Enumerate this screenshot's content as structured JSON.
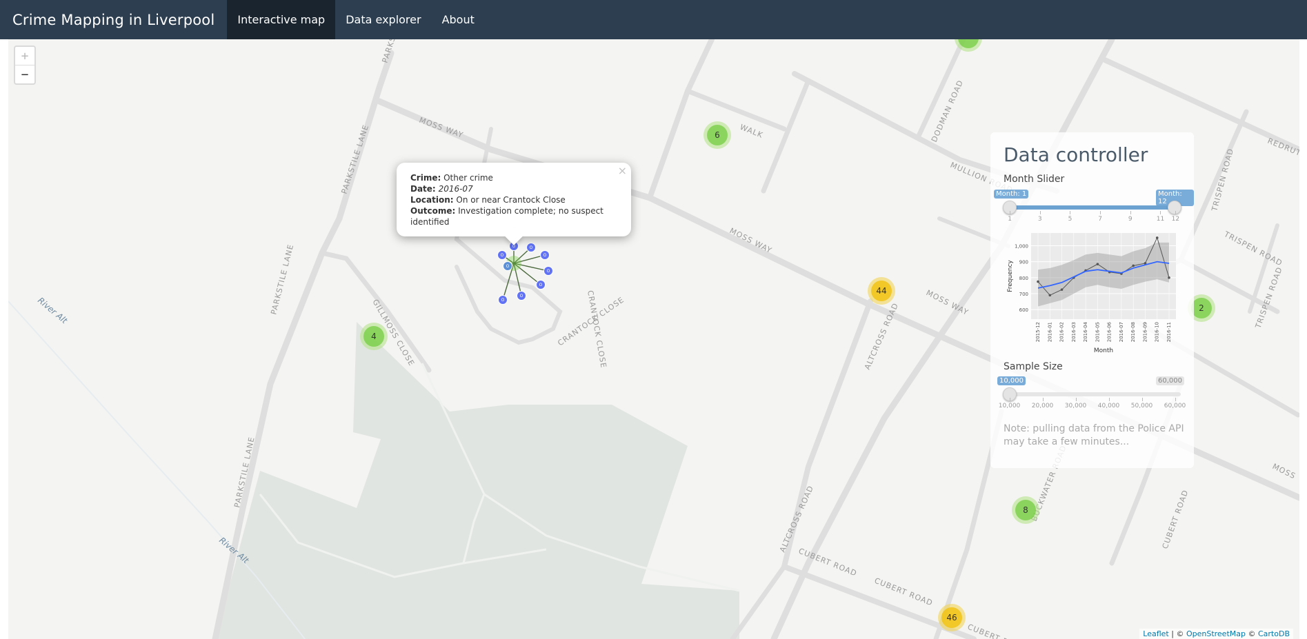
{
  "navbar": {
    "brand": "Crime Mapping in Liverpool",
    "items": [
      {
        "label": "Interactive map",
        "active": true
      },
      {
        "label": "Data explorer",
        "active": false
      },
      {
        "label": "About",
        "active": false
      }
    ]
  },
  "map": {
    "zoom_in": "+",
    "zoom_out": "−",
    "streets": {
      "moss_way_1": "MOSS WAY",
      "moss_way_2": "MOSS WAY",
      "moss_way_3": "MOSS WAY",
      "parkstile_lane_1": "PARKSTILE LANE",
      "parkstile_lane_2": "PARKSTILE LANE",
      "parkstile_lane_3": "PARKSTILE LANE",
      "parkstile_top": "PARKSTILE",
      "gillmoss_close": "GILLMOSS CLOSE",
      "crantock_close_1": "CRANTOCK CLOSE",
      "crantock_close_2": "CRANTOCK CLOSE",
      "mullion_road": "MULLION ROAD",
      "dodman_road": "DODMAN ROAD",
      "altcross_road_1": "ALTCROSS ROAD",
      "altcross_road_2": "ALTCROSS ROAD",
      "cubert_road_1": "CUBERT ROAD",
      "cubert_road_2": "CUBERT ROAD",
      "cubert_road_3": "CUBERT ROAD",
      "cubert_road_4": "CUBERT ROAD",
      "buckwater_road": "BUCKWATER ROAD",
      "trispen_road_1": "TRISPEN ROAD",
      "trispen_road_2": "TRISPEN ROAD",
      "trispen_road_3": "TRISPEN ROAD",
      "redruth": "REDRUT",
      "walk": "WALK",
      "moss_edge": "MOSS"
    },
    "rivers": {
      "river_1": "River Alt",
      "river_2": "River Alt"
    },
    "clusters": [
      {
        "count": "6",
        "color": "green"
      },
      {
        "count": "4",
        "color": "green"
      },
      {
        "count": "44",
        "color": "yellow"
      },
      {
        "count": "2",
        "color": "green"
      },
      {
        "count": "8",
        "color": "green"
      },
      {
        "count": "46",
        "color": "yellow"
      },
      {
        "count": "",
        "color": "green"
      }
    ],
    "spider_marker_labels": [
      "O",
      "O",
      "O",
      "O",
      "O",
      "O",
      "O",
      "O",
      "O"
    ],
    "attribution": {
      "leaflet": "Leaflet",
      "sep1": " | © ",
      "osm": "OpenStreetMap",
      "sep2": " © ",
      "carto": "CartoDB"
    }
  },
  "popup": {
    "crime_label": "Crime:",
    "crime_value": "Other crime",
    "date_label": "Date:",
    "date_value": "2016-07",
    "location_label": "Location:",
    "location_value": "On or near Crantock Close",
    "outcome_label": "Outcome:",
    "outcome_value": "Investigation complete; no suspect identified",
    "close": "×"
  },
  "panel": {
    "title": "Data controller",
    "month_slider": {
      "label": "Month Slider",
      "from_label": "Month: 1",
      "to_label": "Month: 12",
      "min": 1,
      "max": 12,
      "from": 1,
      "to": 12,
      "ticks": [
        "1",
        "3",
        "5",
        "7",
        "9",
        "11",
        "12"
      ]
    },
    "chart_data": {
      "type": "line",
      "title": "",
      "xlabel": "Month",
      "ylabel": "Frequency",
      "categories": [
        "2015-12",
        "2016-01",
        "2016-02",
        "2016-03",
        "2016-04",
        "2016-05",
        "2016-06",
        "2016-07",
        "2016-08",
        "2016-09",
        "2016-10",
        "2016-11"
      ],
      "series": [
        {
          "values": [
            775,
            690,
            725,
            800,
            845,
            885,
            835,
            825,
            875,
            890,
            1050,
            800
          ],
          "color": "#555555"
        },
        {
          "values": [
            735,
            750,
            770,
            805,
            840,
            850,
            840,
            830,
            860,
            880,
            900,
            890
          ],
          "color": "#3366ff"
        }
      ],
      "band_lower": [
        620,
        640,
        660,
        700,
        740,
        755,
        740,
        730,
        755,
        775,
        790,
        770
      ],
      "band_upper": [
        850,
        860,
        880,
        910,
        945,
        955,
        945,
        935,
        965,
        985,
        1020,
        1020
      ],
      "yticks": [
        "1,000",
        "900",
        "800",
        "700",
        "600"
      ],
      "ylim": [
        540,
        1080
      ],
      "grid": true
    },
    "sample_size": {
      "label": "Sample Size",
      "from_label": "10,000",
      "to_label": "60,000",
      "min": 10000,
      "max": 60000,
      "value": 10000,
      "ticks": [
        "10,000",
        "20,000",
        "30,000",
        "40,000",
        "50,000",
        "60,000"
      ]
    },
    "note": "Note: pulling data from the Police API may take a few minutes..."
  }
}
